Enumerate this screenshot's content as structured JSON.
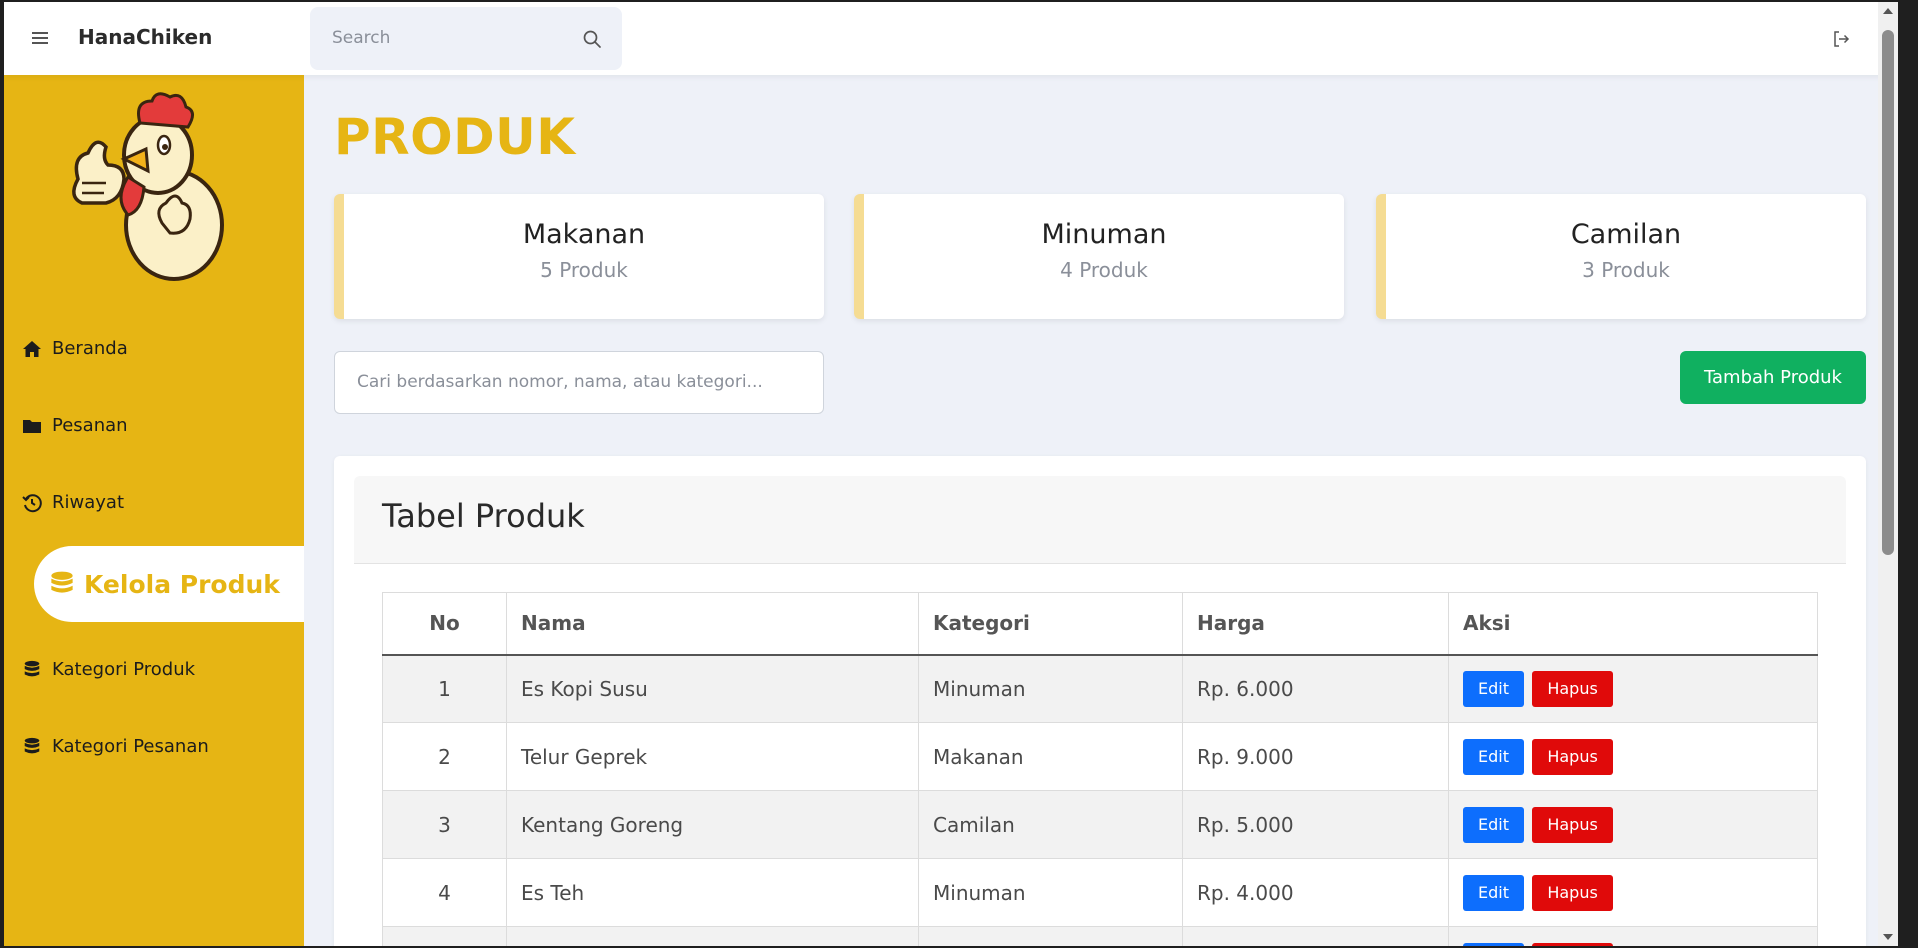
{
  "topbar": {
    "brand": "HanaChiken",
    "search_placeholder": "Search"
  },
  "sidebar": {
    "items": [
      {
        "label": "Beranda",
        "icon": "home-icon"
      },
      {
        "label": "Pesanan",
        "icon": "folder-icon"
      },
      {
        "label": "Riwayat",
        "icon": "history-icon"
      },
      {
        "label": "Kelola Produk",
        "icon": "database-icon",
        "active": true
      },
      {
        "label": "Kategori Produk",
        "icon": "database-icon"
      },
      {
        "label": "Kategori Pesanan",
        "icon": "database-icon"
      }
    ]
  },
  "main": {
    "title": "PRODUK",
    "cards": [
      {
        "title": "Makanan",
        "count": "5 Produk"
      },
      {
        "title": "Minuman",
        "count": "4 Produk"
      },
      {
        "title": "Camilan",
        "count": "3 Produk"
      }
    ],
    "filter_placeholder": "Cari berdasarkan nomor, nama, atau kategori...",
    "add_button": "Tambah Produk",
    "table": {
      "title": "Tabel Produk",
      "headers": [
        "No",
        "Nama",
        "Kategori",
        "Harga",
        "Aksi"
      ],
      "rows": [
        {
          "no": "1",
          "nama": "Es Kopi Susu",
          "kategori": "Minuman",
          "harga": "Rp. 6.000"
        },
        {
          "no": "2",
          "nama": "Telur Geprek",
          "kategori": "Makanan",
          "harga": "Rp. 9.000"
        },
        {
          "no": "3",
          "nama": "Kentang Goreng",
          "kategori": "Camilan",
          "harga": "Rp. 5.000"
        },
        {
          "no": "4",
          "nama": "Es Teh",
          "kategori": "Minuman",
          "harga": "Rp. 4.000"
        }
      ],
      "edit_label": "Edit",
      "delete_label": "Hapus"
    }
  },
  "colors": {
    "brand_yellow": "#e6b514",
    "add_green": "#10b060",
    "edit_blue": "#0d6efd",
    "delete_red": "#e00a0a"
  }
}
